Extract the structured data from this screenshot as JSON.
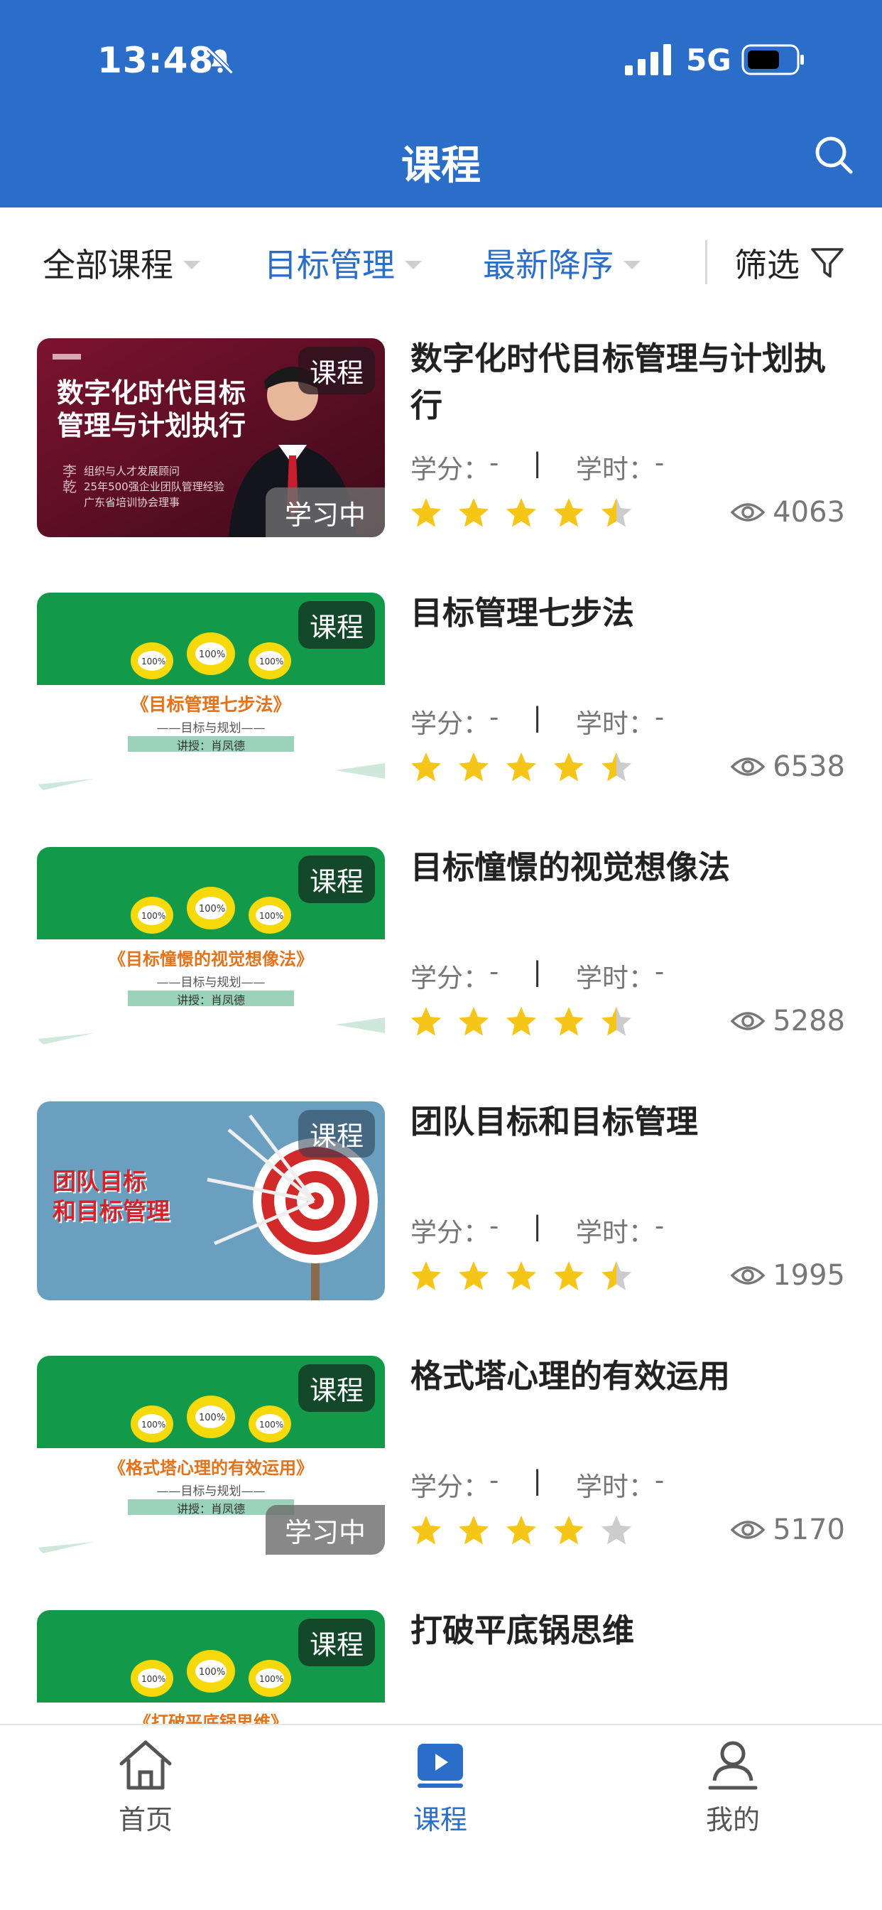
{
  "status_bar": {
    "time": "13:48",
    "network": "5G"
  },
  "header": {
    "title": "课程"
  },
  "filters": {
    "category": "全部课程",
    "topic": "目标管理",
    "sort": "最新降序",
    "filter_label": "筛选"
  },
  "courses": [
    {
      "title": "数字化时代目标管理与计划执行",
      "badge": "课程",
      "status": "学习中",
      "credit_label": "学分：",
      "credit": "-",
      "hours_label": "学时：",
      "hours": "-",
      "rating": 4.5,
      "views": "4063",
      "thumb_text": {
        "line1": "数字化时代目标",
        "line2": "管理与计划执行",
        "name": "李乾",
        "info1": "组织与人才发展顾问",
        "info2": "25年500强企业团队管理经验",
        "info3": "广东省培训协会理事"
      }
    },
    {
      "title": "目标管理七步法",
      "badge": "课程",
      "status": "",
      "credit_label": "学分：",
      "credit": "-",
      "hours_label": "学时：",
      "hours": "-",
      "rating": 4.5,
      "views": "6538",
      "thumb_text": {
        "line1": "《目标管理七步法》",
        "line2": "——目标与规划——",
        "name": "讲授：肖凤德",
        "pct": "100%"
      }
    },
    {
      "title": "目标憧憬的视觉想像法",
      "badge": "课程",
      "status": "",
      "credit_label": "学分：",
      "credit": "-",
      "hours_label": "学时：",
      "hours": "-",
      "rating": 4.5,
      "views": "5288",
      "thumb_text": {
        "line1": "《目标憧憬的视觉想像法》",
        "line2": "——目标与规划——",
        "name": "讲授：肖凤德",
        "pct": "100%"
      }
    },
    {
      "title": "团队目标和目标管理",
      "badge": "课程",
      "status": "",
      "credit_label": "学分：",
      "credit": "-",
      "hours_label": "学时：",
      "hours": "-",
      "rating": 4.5,
      "views": "1995",
      "thumb_text": {
        "line1": "团队目标",
        "line2": "和目标管理"
      }
    },
    {
      "title": "格式塔心理的有效运用",
      "badge": "课程",
      "status": "学习中",
      "credit_label": "学分：",
      "credit": "-",
      "hours_label": "学时：",
      "hours": "-",
      "rating": 4,
      "views": "5170",
      "thumb_text": {
        "line1": "《格式塔心理的有效运用》",
        "line2": "——目标与规划——",
        "name": "讲授：肖凤德",
        "pct": "100%"
      }
    },
    {
      "title": "打破平底锅思维",
      "badge": "课程",
      "status": "",
      "thumb_text": {
        "line1": "《打破平底锅思维》",
        "pct": "100%"
      }
    }
  ],
  "tabs": [
    {
      "label": "首页",
      "icon": "home-icon"
    },
    {
      "label": "课程",
      "icon": "play-icon",
      "active": true
    },
    {
      "label": "我的",
      "icon": "user-icon"
    }
  ],
  "colors": {
    "primary": "#2b6ec9",
    "star": "#f5c518",
    "star_empty": "#cccccc",
    "green_banner": "#129a4a"
  }
}
